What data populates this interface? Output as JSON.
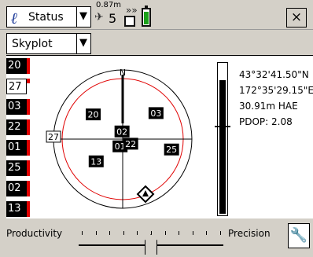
{
  "header": {
    "status_label": "Status",
    "accuracy": "0.87m",
    "satellite_count": "5",
    "close_label": "×"
  },
  "view": {
    "selected": "Skyplot"
  },
  "satellites_list": [
    {
      "id": "20",
      "style": "dark",
      "snr": 1.0
    },
    {
      "id": "27",
      "style": "light",
      "snr": 0.3
    },
    {
      "id": "03",
      "style": "dark",
      "snr": 1.0
    },
    {
      "id": "22",
      "style": "dark",
      "snr": 1.0
    },
    {
      "id": "01",
      "style": "dark",
      "snr": 1.0
    },
    {
      "id": "25",
      "style": "dark",
      "snr": 1.0
    },
    {
      "id": "02",
      "style": "dark",
      "snr": 1.0
    },
    {
      "id": "13",
      "style": "dark",
      "snr": 1.0
    }
  ],
  "skyplot": {
    "north_label": "N",
    "satellites": [
      {
        "id": "03",
        "style": "dark",
        "az": 52,
        "elev": 35
      },
      {
        "id": "20",
        "style": "dark",
        "az": 310,
        "elev": 40
      },
      {
        "id": "02",
        "style": "dark",
        "az": 355,
        "elev": 80
      },
      {
        "id": "27",
        "style": "light",
        "az": 272,
        "elev": 0
      },
      {
        "id": "01",
        "style": "dark",
        "az": 200,
        "elev": 80
      },
      {
        "id": "22",
        "style": "dark",
        "az": 120,
        "elev": 78
      },
      {
        "id": "25",
        "style": "dark",
        "az": 102,
        "elev": 25
      },
      {
        "id": "13",
        "style": "dark",
        "az": 230,
        "elev": 45
      }
    ]
  },
  "position": {
    "latitude": "43°32'41.50\"N",
    "longitude": "172°35'29.15\"E",
    "height": "30.91m HAE",
    "pdop": "PDOP: 2.08"
  },
  "slider": {
    "left_label": "Productivity",
    "right_label": "Precision",
    "value_fraction": 0.5,
    "tick_count": 11
  },
  "icons": {
    "status": "status-icon",
    "satellite": "satellite-icon",
    "radio": "radio-icon",
    "battery": "battery-icon",
    "wrench": "wrench-icon",
    "position": "position-marker-icon"
  },
  "colors": {
    "accent_red": "#e00000",
    "battery_green": "#1aa01a",
    "status_blue": "#1f3c9a"
  }
}
